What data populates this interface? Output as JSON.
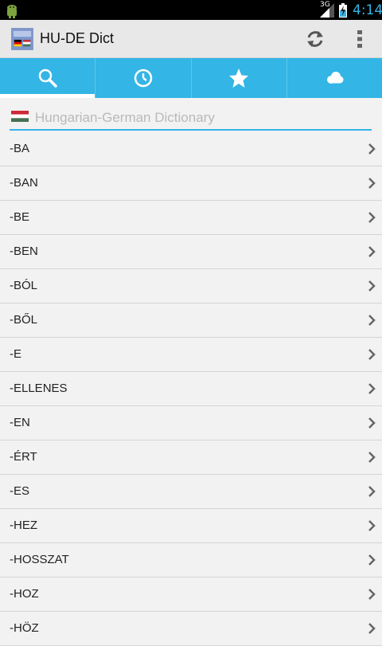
{
  "status_bar": {
    "network": "3G",
    "time": "4:14",
    "icons": [
      "android-icon",
      "signal-icon",
      "battery-charging-icon"
    ]
  },
  "action_bar": {
    "title": "HU-DE Dict",
    "icons": [
      "app-icon",
      "refresh-icon",
      "overflow-menu-icon"
    ]
  },
  "tabs": [
    {
      "icon": "search-icon",
      "active": true
    },
    {
      "icon": "clock-icon",
      "active": false
    },
    {
      "icon": "star-icon",
      "active": false
    },
    {
      "icon": "cloud-icon",
      "active": false
    }
  ],
  "search": {
    "placeholder": "Hungarian-German Dictionary",
    "value": "",
    "flag": "hungary-flag-icon"
  },
  "colors": {
    "accent": "#33b5e5",
    "background": "#f2f2f2",
    "action_bar": "#e8e8e8"
  },
  "words": [
    "-BA",
    "-BAN",
    "-BE",
    "-BEN",
    "-BÓL",
    "-BŐL",
    "-E",
    "-ELLENES",
    "-EN",
    "-ÉRT",
    "-ES",
    "-HEZ",
    "-HOSSZAT",
    "-HOZ",
    "-HÖZ"
  ]
}
